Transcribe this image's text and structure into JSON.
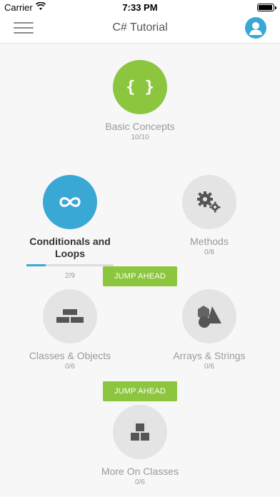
{
  "status_bar": {
    "carrier": "Carrier",
    "time": "7:33 PM"
  },
  "nav": {
    "title": "C# Tutorial",
    "menu_icon": "hamburger-icon",
    "profile_icon": "user-icon"
  },
  "colors": {
    "accent_green": "#8cc63f",
    "accent_blue": "#3aa8d4",
    "locked_gray": "#e4e4e4"
  },
  "lessons": [
    {
      "title": "Basic Concepts",
      "progress": "10/10",
      "icon": "braces-icon"
    },
    {
      "title": "Conditionals and Loops",
      "progress": "2/9",
      "icon": "infinity-icon",
      "completion": 0.22
    },
    {
      "title": "Methods",
      "progress": "0/8",
      "icon": "gears-icon"
    },
    {
      "title": "Classes & Objects",
      "progress": "0/6",
      "icon": "bricks-icon"
    },
    {
      "title": "Arrays & Strings",
      "progress": "0/6",
      "icon": "shapes-icon"
    },
    {
      "title": "More On Classes",
      "progress": "0/6",
      "icon": "stacked-boxes-icon"
    }
  ],
  "jump_buttons": [
    {
      "label": "JUMP AHEAD"
    },
    {
      "label": "JUMP AHEAD"
    }
  ]
}
